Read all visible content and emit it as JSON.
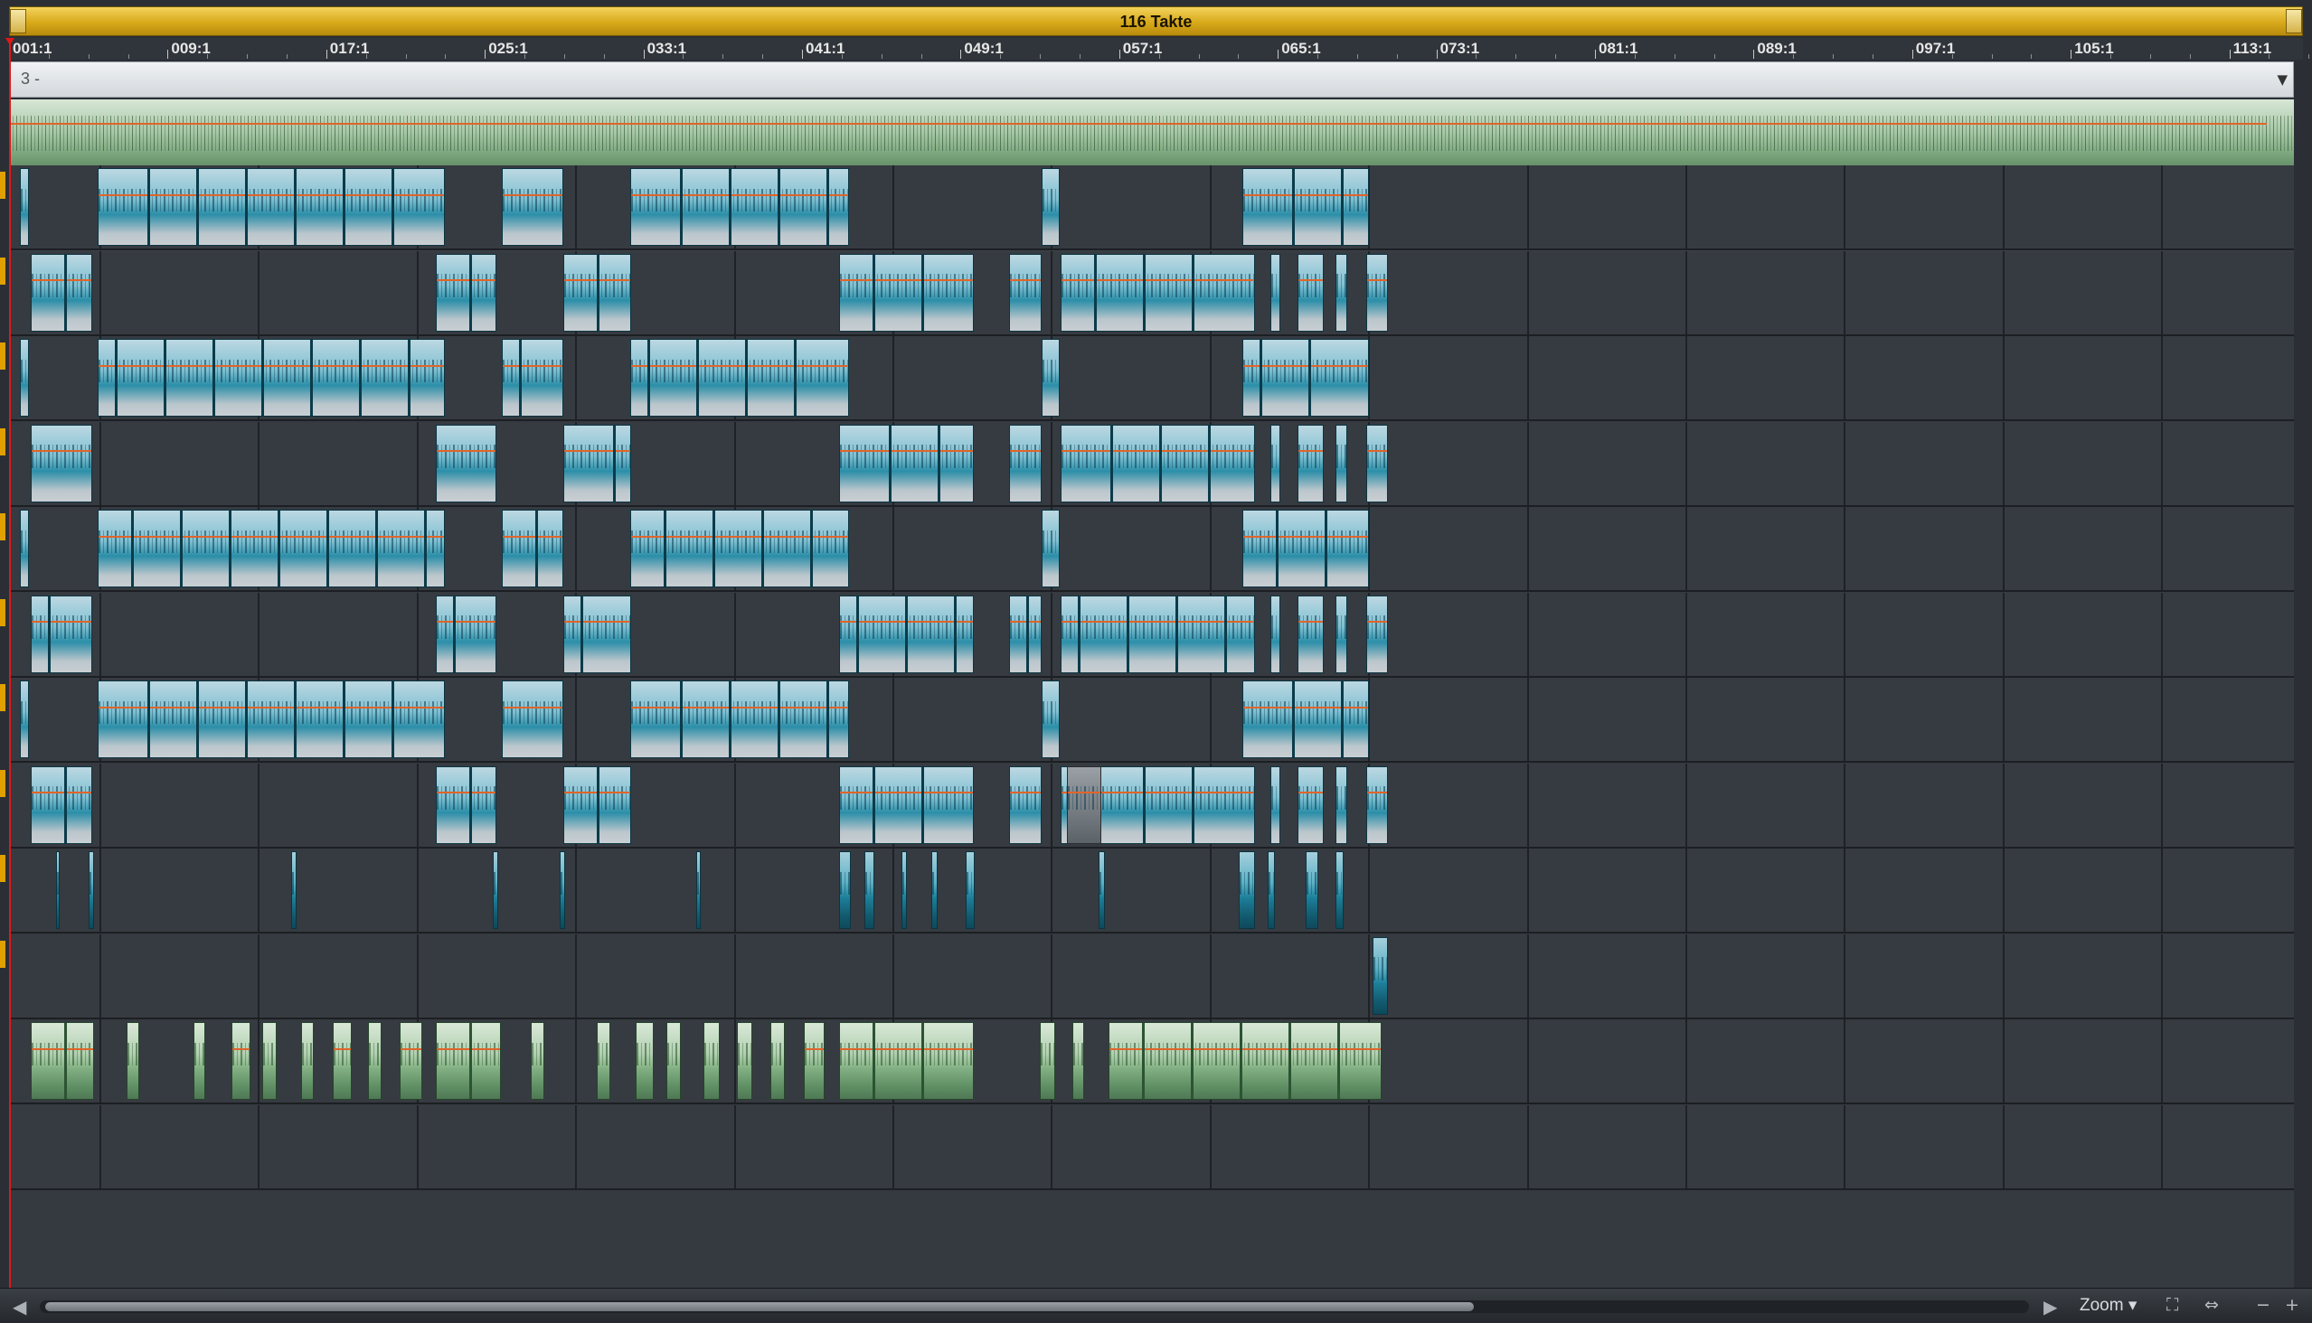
{
  "range_bar": {
    "label": "116 Takte"
  },
  "ruler": {
    "labels": [
      "001:1",
      "009:1",
      "017:1",
      "025:1",
      "033:1",
      "041:1",
      "049:1",
      "057:1",
      "065:1",
      "073:1",
      "081:1",
      "089:1",
      "097:1",
      "105:1",
      "113:1"
    ]
  },
  "marker_lane": {
    "label": "3 -",
    "dropdown_icon": "chevron-down-icon"
  },
  "bottom_bar": {
    "zoom_label": "Zoom",
    "icons": [
      "scroll-left-icon",
      "scroll-right-icon",
      "zoom-dropdown-icon",
      "fit-to-window-icon",
      "horizontal-resize-icon",
      "zoom-out-icon",
      "zoom-in-icon"
    ]
  },
  "colors": {
    "range_bar": "#d8a91a",
    "audio_clip": "#4fa9c0",
    "master_clip": "#9cc29b",
    "volume_curve": "#e0652a",
    "playhead": "#e01818"
  }
}
